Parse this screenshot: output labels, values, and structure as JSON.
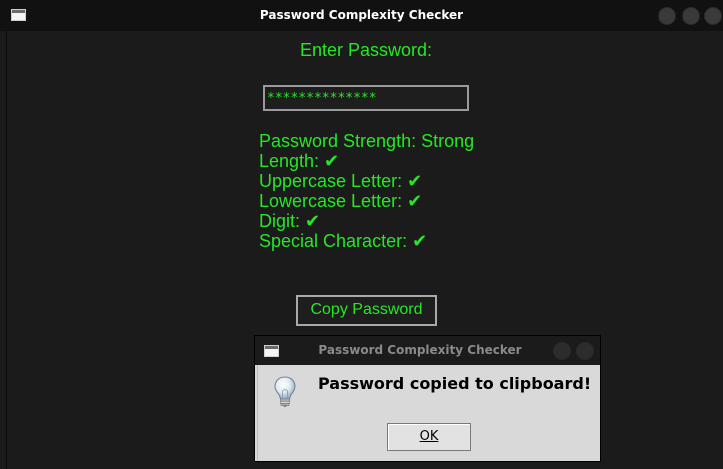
{
  "window": {
    "title": "Password Complexity Checker"
  },
  "form": {
    "enter_label": "Enter Password:",
    "password_masked": "**************",
    "copy_button": "Copy Password"
  },
  "results": {
    "strength": "Password Strength: Strong",
    "length": "Length: ✔",
    "uppercase": "Uppercase Letter: ✔",
    "lowercase": "Lowercase Letter: ✔",
    "digit": "Digit: ✔",
    "special": "Special Character: ✔"
  },
  "dialog": {
    "title": "Password Complexity Checker",
    "message": "Password copied to clipboard!",
    "ok_label": "OK",
    "icon": "lightbulb-info-icon"
  },
  "colors": {
    "accent_green": "#27e627",
    "background": "#1b1b1b"
  }
}
